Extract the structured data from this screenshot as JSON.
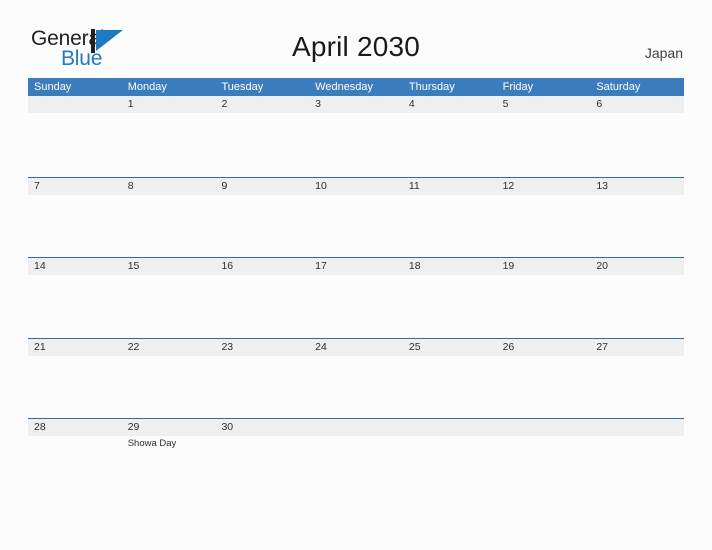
{
  "logo": {
    "word_one": "General",
    "word_two": "Blue",
    "mark": "flag-triangle"
  },
  "header": {
    "title": "April 2030",
    "country": "Japan"
  },
  "colors": {
    "header_blue": "#3b7cbd",
    "row_border_blue": "#2b6cad",
    "date_band_gray": "#efeff0",
    "logo_blue": "#1f7ac4",
    "page_background": "#fcfcfc",
    "text_dark": "#2e2e2e"
  },
  "calendar": {
    "month": "April",
    "year": "2030",
    "weekday_headers": [
      "Sunday",
      "Monday",
      "Tuesday",
      "Wednesday",
      "Thursday",
      "Friday",
      "Saturday"
    ],
    "weeks": [
      [
        {
          "date": "",
          "event": ""
        },
        {
          "date": "1",
          "event": ""
        },
        {
          "date": "2",
          "event": ""
        },
        {
          "date": "3",
          "event": ""
        },
        {
          "date": "4",
          "event": ""
        },
        {
          "date": "5",
          "event": ""
        },
        {
          "date": "6",
          "event": ""
        }
      ],
      [
        {
          "date": "7",
          "event": ""
        },
        {
          "date": "8",
          "event": ""
        },
        {
          "date": "9",
          "event": ""
        },
        {
          "date": "10",
          "event": ""
        },
        {
          "date": "11",
          "event": ""
        },
        {
          "date": "12",
          "event": ""
        },
        {
          "date": "13",
          "event": ""
        }
      ],
      [
        {
          "date": "14",
          "event": ""
        },
        {
          "date": "15",
          "event": ""
        },
        {
          "date": "16",
          "event": ""
        },
        {
          "date": "17",
          "event": ""
        },
        {
          "date": "18",
          "event": ""
        },
        {
          "date": "19",
          "event": ""
        },
        {
          "date": "20",
          "event": ""
        }
      ],
      [
        {
          "date": "21",
          "event": ""
        },
        {
          "date": "22",
          "event": ""
        },
        {
          "date": "23",
          "event": ""
        },
        {
          "date": "24",
          "event": ""
        },
        {
          "date": "25",
          "event": ""
        },
        {
          "date": "26",
          "event": ""
        },
        {
          "date": "27",
          "event": ""
        }
      ],
      [
        {
          "date": "28",
          "event": ""
        },
        {
          "date": "29",
          "event": "Showa Day"
        },
        {
          "date": "30",
          "event": ""
        },
        {
          "date": "",
          "event": ""
        },
        {
          "date": "",
          "event": ""
        },
        {
          "date": "",
          "event": ""
        },
        {
          "date": "",
          "event": ""
        }
      ]
    ]
  }
}
